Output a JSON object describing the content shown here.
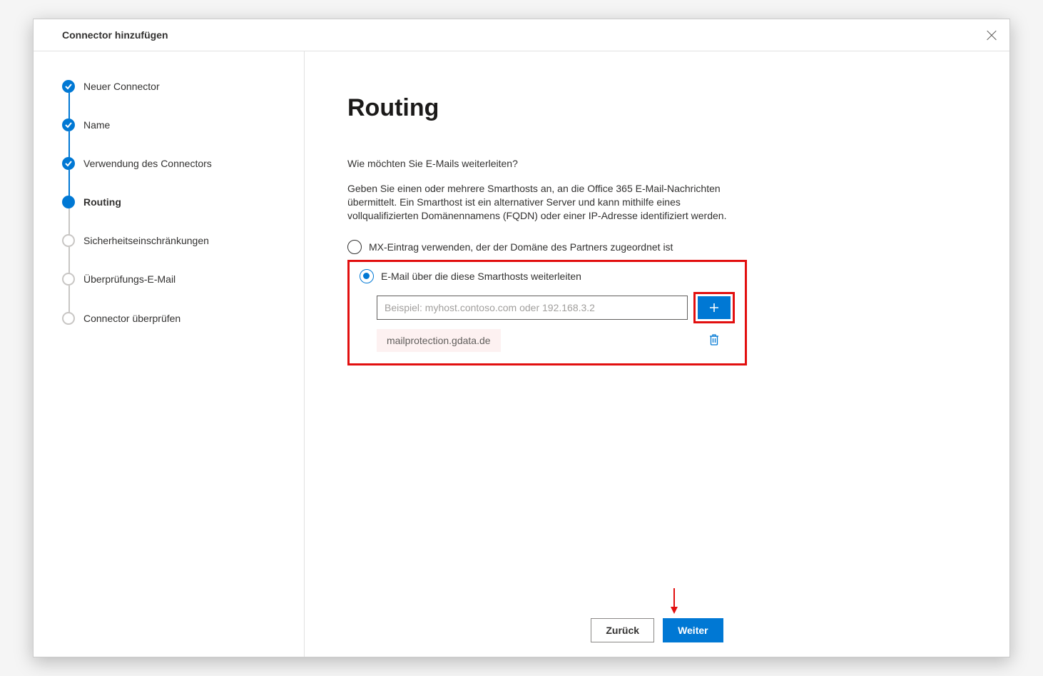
{
  "header": {
    "title": "Connector hinzufügen"
  },
  "steps": [
    {
      "label": "Neuer Connector",
      "state": "done"
    },
    {
      "label": "Name",
      "state": "done"
    },
    {
      "label": "Verwendung des Connectors",
      "state": "done"
    },
    {
      "label": "Routing",
      "state": "current"
    },
    {
      "label": "Sicherheitseinschränkungen",
      "state": "pending"
    },
    {
      "label": "Überprüfungs-E-Mail",
      "state": "pending"
    },
    {
      "label": "Connector überprüfen",
      "state": "pending"
    }
  ],
  "main": {
    "title": "Routing",
    "subhead": "Wie möchten Sie E-Mails weiterleiten?",
    "desc": "Geben Sie einen oder mehrere Smarthosts an, an die Office 365 E-Mail-Nachrichten übermittelt. Ein Smarthost ist ein alternativer Server und kann mithilfe eines vollqualifizierten Domänennamens (FQDN) oder einer IP-Adresse identifiziert werden.",
    "options": {
      "mx": "MX-Eintrag verwenden, der der Domäne des Partners zugeordnet ist",
      "smarthost": "E-Mail über die diese Smarthosts weiterleiten"
    },
    "smarthost_placeholder": "Beispiel: myhost.contoso.com oder 192.168.3.2",
    "hosts": [
      "mailprotection.gdata.de"
    ]
  },
  "footer": {
    "back": "Zurück",
    "next": "Weiter"
  }
}
